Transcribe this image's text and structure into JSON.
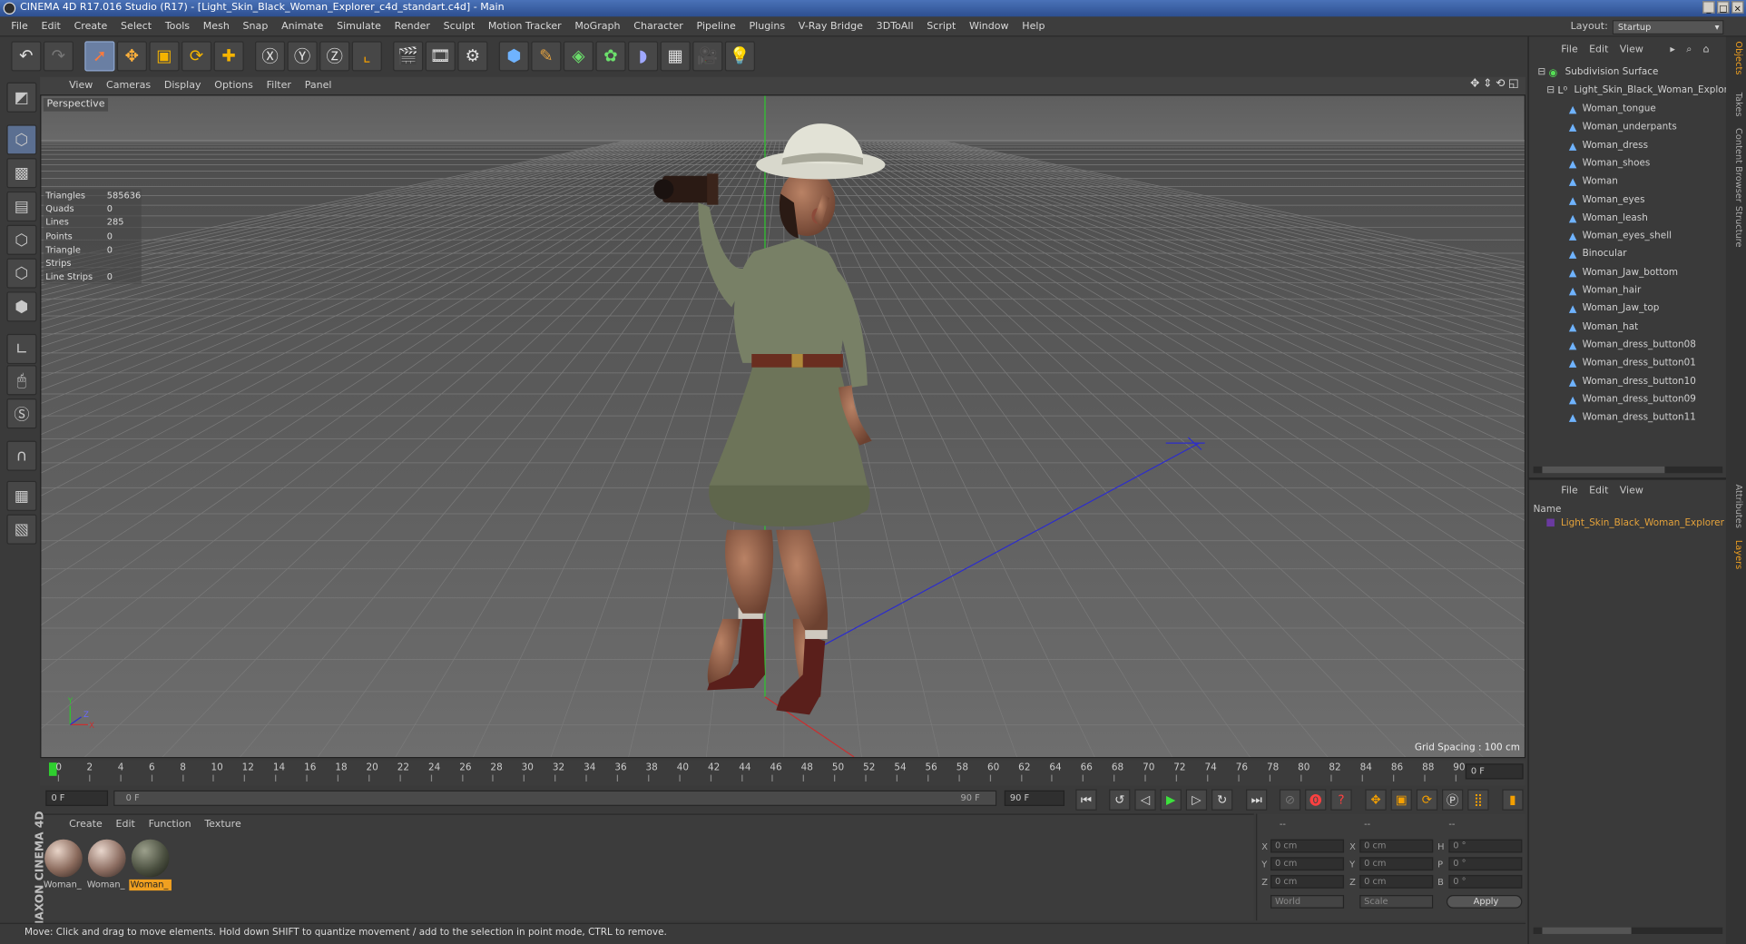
{
  "window": {
    "title": "CINEMA 4D R17.016 Studio (R17) - [Light_Skin_Black_Woman_Explorer_c4d_standart.c4d] - Main"
  },
  "menu": [
    "File",
    "Edit",
    "Create",
    "Select",
    "Tools",
    "Mesh",
    "Snap",
    "Animate",
    "Simulate",
    "Render",
    "Sculpt",
    "Motion Tracker",
    "MoGraph",
    "Character",
    "Pipeline",
    "Plugins",
    "V-Ray Bridge",
    "3DToAll",
    "Script",
    "Window",
    "Help"
  ],
  "layout": {
    "label": "Layout:",
    "value": "Startup"
  },
  "viewport": {
    "menu": [
      "View",
      "Cameras",
      "Display",
      "Options",
      "Filter",
      "Panel"
    ],
    "label": "Perspective",
    "grid_spacing": "Grid Spacing : 100 cm",
    "stats": [
      {
        "k": "Triangles",
        "v": "585636"
      },
      {
        "k": "Quads",
        "v": "0"
      },
      {
        "k": "Lines",
        "v": "285"
      },
      {
        "k": "Points",
        "v": "0"
      },
      {
        "k": "Triangle Strips",
        "v": "0"
      },
      {
        "k": "Line Strips",
        "v": "0"
      }
    ]
  },
  "timeline": {
    "ticks": [
      "0",
      "2",
      "4",
      "6",
      "8",
      "10",
      "12",
      "14",
      "16",
      "18",
      "20",
      "22",
      "24",
      "26",
      "28",
      "30",
      "32",
      "34",
      "36",
      "38",
      "40",
      "42",
      "44",
      "46",
      "48",
      "50",
      "52",
      "54",
      "56",
      "58",
      "60",
      "62",
      "64",
      "66",
      "68",
      "70",
      "72",
      "74",
      "76",
      "78",
      "80",
      "82",
      "84",
      "86",
      "88",
      "90"
    ],
    "current_frame": "0 F",
    "start": "0 F",
    "range_start": "0 F",
    "range_end": "90 F",
    "end": "90 F"
  },
  "materials": {
    "menu": [
      "Create",
      "Edit",
      "Function",
      "Texture"
    ],
    "items": [
      {
        "label": "Woman_",
        "color": "#8a6a5c"
      },
      {
        "label": "Woman_",
        "color": "#8d6e62"
      },
      {
        "label": "Woman_",
        "color": "#4b5040",
        "selected": true
      }
    ]
  },
  "coords": {
    "headers": [
      "--",
      "--",
      "--"
    ],
    "rows": [
      {
        "a": "X",
        "av": "0 cm",
        "b": "X",
        "bv": "0 cm",
        "c": "H",
        "cv": "0 °"
      },
      {
        "a": "Y",
        "av": "0 cm",
        "b": "Y",
        "bv": "0 cm",
        "c": "P",
        "cv": "0 °"
      },
      {
        "a": "Z",
        "av": "0 cm",
        "b": "Z",
        "bv": "0 cm",
        "c": "B",
        "cv": "0 °"
      }
    ],
    "world": "World",
    "scale": "Scale",
    "apply": "Apply"
  },
  "status": "Move: Click and drag to move elements. Hold down SHIFT to quantize movement / add to the selection in point mode, CTRL to remove.",
  "objects": {
    "menu": [
      "File",
      "Edit",
      "View"
    ],
    "root": "Subdivision Surface",
    "group": "Light_Skin_Black_Woman_Explorer",
    "items": [
      "Woman_tongue",
      "Woman_underpants",
      "Woman_dress",
      "Woman_shoes",
      "Woman",
      "Woman_eyes",
      "Woman_leash",
      "Woman_eyes_shell",
      "Binocular",
      "Woman_Jaw_bottom",
      "Woman_hair",
      "Woman_Jaw_top",
      "Woman_hat",
      "Woman_dress_button08",
      "Woman_dress_button01",
      "Woman_dress_button10",
      "Woman_dress_button09",
      "Woman_dress_button11"
    ]
  },
  "layers": {
    "menu": [
      "File",
      "Edit",
      "View"
    ],
    "name_header": "Name",
    "items": [
      "Light_Skin_Black_Woman_Explorer"
    ]
  },
  "side_tabs": [
    "Objects",
    "Takes",
    "Content Browser",
    "Structure",
    "Attributes",
    "Layers"
  ],
  "maxon": "MAXON CINEMA 4D"
}
